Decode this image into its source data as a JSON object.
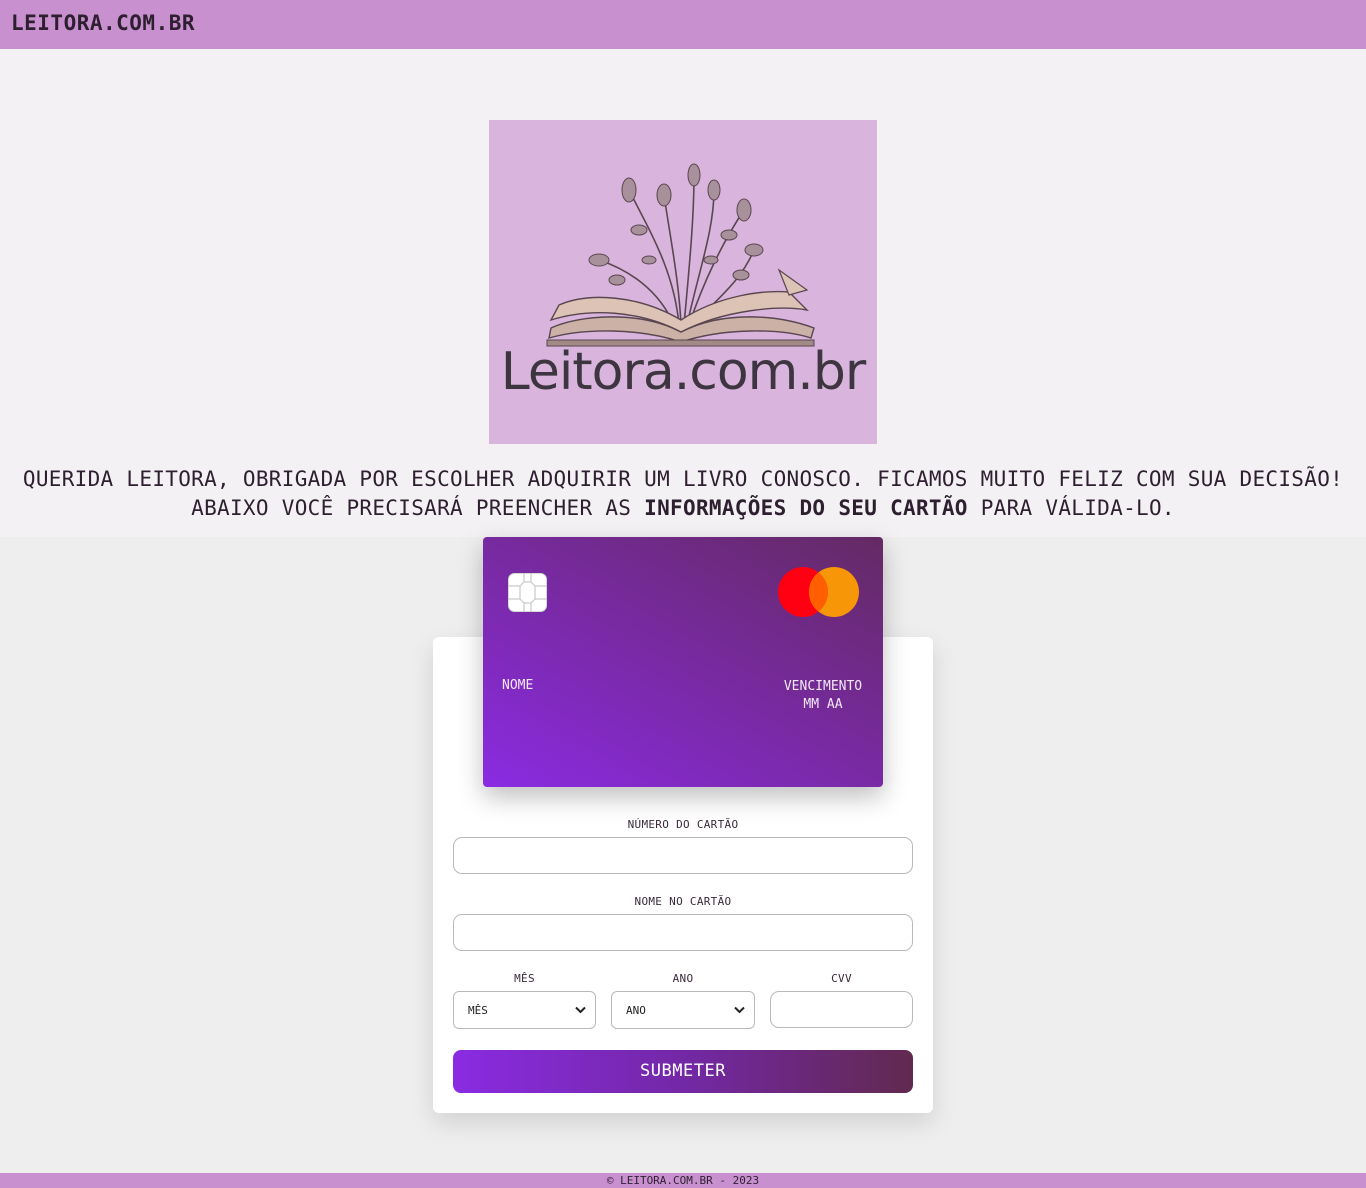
{
  "header": {
    "brand": "LEITORA.COM.BR"
  },
  "logo": {
    "text": "Leitora.com.br"
  },
  "intro": {
    "text_before": "QUERIDA LEITORA, OBRIGADA POR ESCOLHER ADQUIRIR UM LIVRO CONOSCO. FICAMOS MUITO FELIZ COM SUA DECISÃO! ABAIXO VOCÊ PRECISARÁ PREENCHER AS ",
    "text_bold": "INFORMAÇÕES DO SEU CARTÃO",
    "text_after": " PARA VÁLIDA-LO."
  },
  "card": {
    "name_placeholder": "NOME",
    "expiry_label": "VENCIMENTO",
    "expiry_value": "MM AA"
  },
  "form": {
    "card_number_label": "NÚMERO DO CARTÃO",
    "card_number_value": "",
    "card_name_label": "NOME NO CARTÃO",
    "card_name_value": "",
    "month_label": "MÊS",
    "month_selected": "MÊS",
    "year_label": "ANO",
    "year_selected": "ANO",
    "cvv_label": "CVV",
    "cvv_value": "",
    "submit_label": "SUBMETER"
  },
  "footer": {
    "text": "© LEITORA.COM.BR - 2023"
  },
  "icons": {
    "chip": "card-chip-icon",
    "brand": "mastercard-logo-icon",
    "dropdown": "chevron-down-icon"
  },
  "colors": {
    "topbar": "#c890ce",
    "logo_bg": "#d9b5dd",
    "card_start": "#8a2be2",
    "card_end": "#642a63",
    "mc_red": "#ff0012",
    "mc_orange": "#ff9c00"
  }
}
